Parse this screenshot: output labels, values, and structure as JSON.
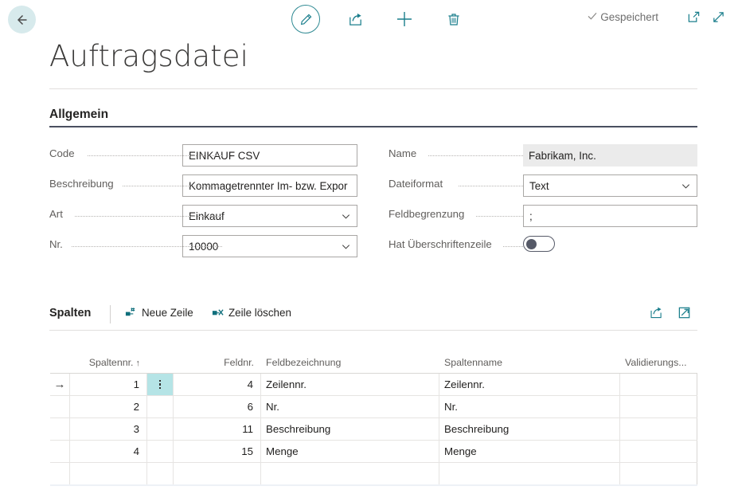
{
  "topbar": {
    "back_label": "Zurück",
    "back_icon": "arrow-left-icon",
    "commands": [
      {
        "name": "edit-button",
        "icon": "pencil-icon",
        "label": "Bearbeiten"
      },
      {
        "name": "share-button",
        "icon": "share-icon",
        "label": "Freigeben"
      },
      {
        "name": "new-button",
        "icon": "plus-icon",
        "label": "Neu"
      },
      {
        "name": "delete-button",
        "icon": "trash-icon",
        "label": "Löschen"
      }
    ],
    "status_text": "Gespeichert",
    "status_icon": "check-icon",
    "open_new_window_icon": "open-in-new-window-icon",
    "fullscreen_icon": "expand-arrows-icon"
  },
  "page": {
    "title": "Auftragsdatei"
  },
  "general": {
    "heading": "Allgemein",
    "left_fields": [
      {
        "label": "Code",
        "value": "EINKAUF CSV",
        "type": "text",
        "readonly": false
      },
      {
        "label": "Beschreibung",
        "value": "Kommagetrennter Im- bzw. Expor",
        "type": "text",
        "readonly": false
      },
      {
        "label": "Art",
        "value": "Einkauf",
        "type": "dropdown",
        "readonly": false
      },
      {
        "label": "Nr.",
        "value": "10000",
        "type": "dropdown",
        "readonly": false
      }
    ],
    "right_fields": [
      {
        "label": "Name",
        "value": "Fabrikam, Inc.",
        "type": "text",
        "readonly": true
      },
      {
        "label": "Dateiformat",
        "value": "Text",
        "type": "dropdown",
        "readonly": false
      },
      {
        "label": "Feldbegrenzung",
        "value": ";",
        "type": "text",
        "readonly": false
      },
      {
        "label": "Hat Überschriftenzeile",
        "value": "",
        "type": "toggle",
        "toggle_on": false,
        "readonly": false
      }
    ]
  },
  "subgrid": {
    "heading": "Spalten",
    "actions": [
      {
        "label": "Neue Zeile",
        "icon": "new-row-icon"
      },
      {
        "label": "Zeile löschen",
        "icon": "delete-row-icon"
      }
    ],
    "icons": [
      {
        "name": "share-grid-icon",
        "label": "Freigeben"
      },
      {
        "name": "open-grid-new-window-icon",
        "label": "In neuem Fenster öffnen"
      }
    ],
    "columns": [
      {
        "label": "Spaltennr.",
        "align": "num",
        "sorted": true,
        "sort_arrow": "↑"
      },
      {
        "label": "Feldnr.",
        "align": "num",
        "sorted": false,
        "sort_arrow": ""
      },
      {
        "label": "Feldbezeichnung",
        "align": "txt",
        "sorted": false,
        "sort_arrow": ""
      },
      {
        "label": "Spaltenname",
        "align": "txt",
        "sorted": false,
        "sort_arrow": ""
      },
      {
        "label": "Validierungs...",
        "align": "txt",
        "sorted": false,
        "sort_arrow": ""
      }
    ],
    "rows": [
      {
        "selected": true,
        "spaltennr": "1",
        "feldnr": "4",
        "feldbezeichnung": "Zeilennr.",
        "spaltenname": "Zeilennr.",
        "validierung": ""
      },
      {
        "selected": false,
        "spaltennr": "2",
        "feldnr": "6",
        "feldbezeichnung": "Nr.",
        "spaltenname": "Nr.",
        "validierung": ""
      },
      {
        "selected": false,
        "spaltennr": "3",
        "feldnr": "11",
        "feldbezeichnung": "Beschreibung",
        "spaltenname": "Beschreibung",
        "validierung": ""
      },
      {
        "selected": false,
        "spaltennr": "4",
        "feldnr": "15",
        "feldbezeichnung": "Menge",
        "spaltenname": "Menge",
        "validierung": ""
      },
      {
        "selected": false,
        "spaltennr": "",
        "feldnr": "",
        "feldbezeichnung": "",
        "spaltenname": "",
        "validierung": ""
      }
    ]
  },
  "colors": {
    "accent": "#0f6f7c",
    "back_circle": "#d7eaec",
    "selected_cell": "#b5e4e6",
    "section_underline": "#4a4f60",
    "readonly_bg": "#ebebeb"
  }
}
